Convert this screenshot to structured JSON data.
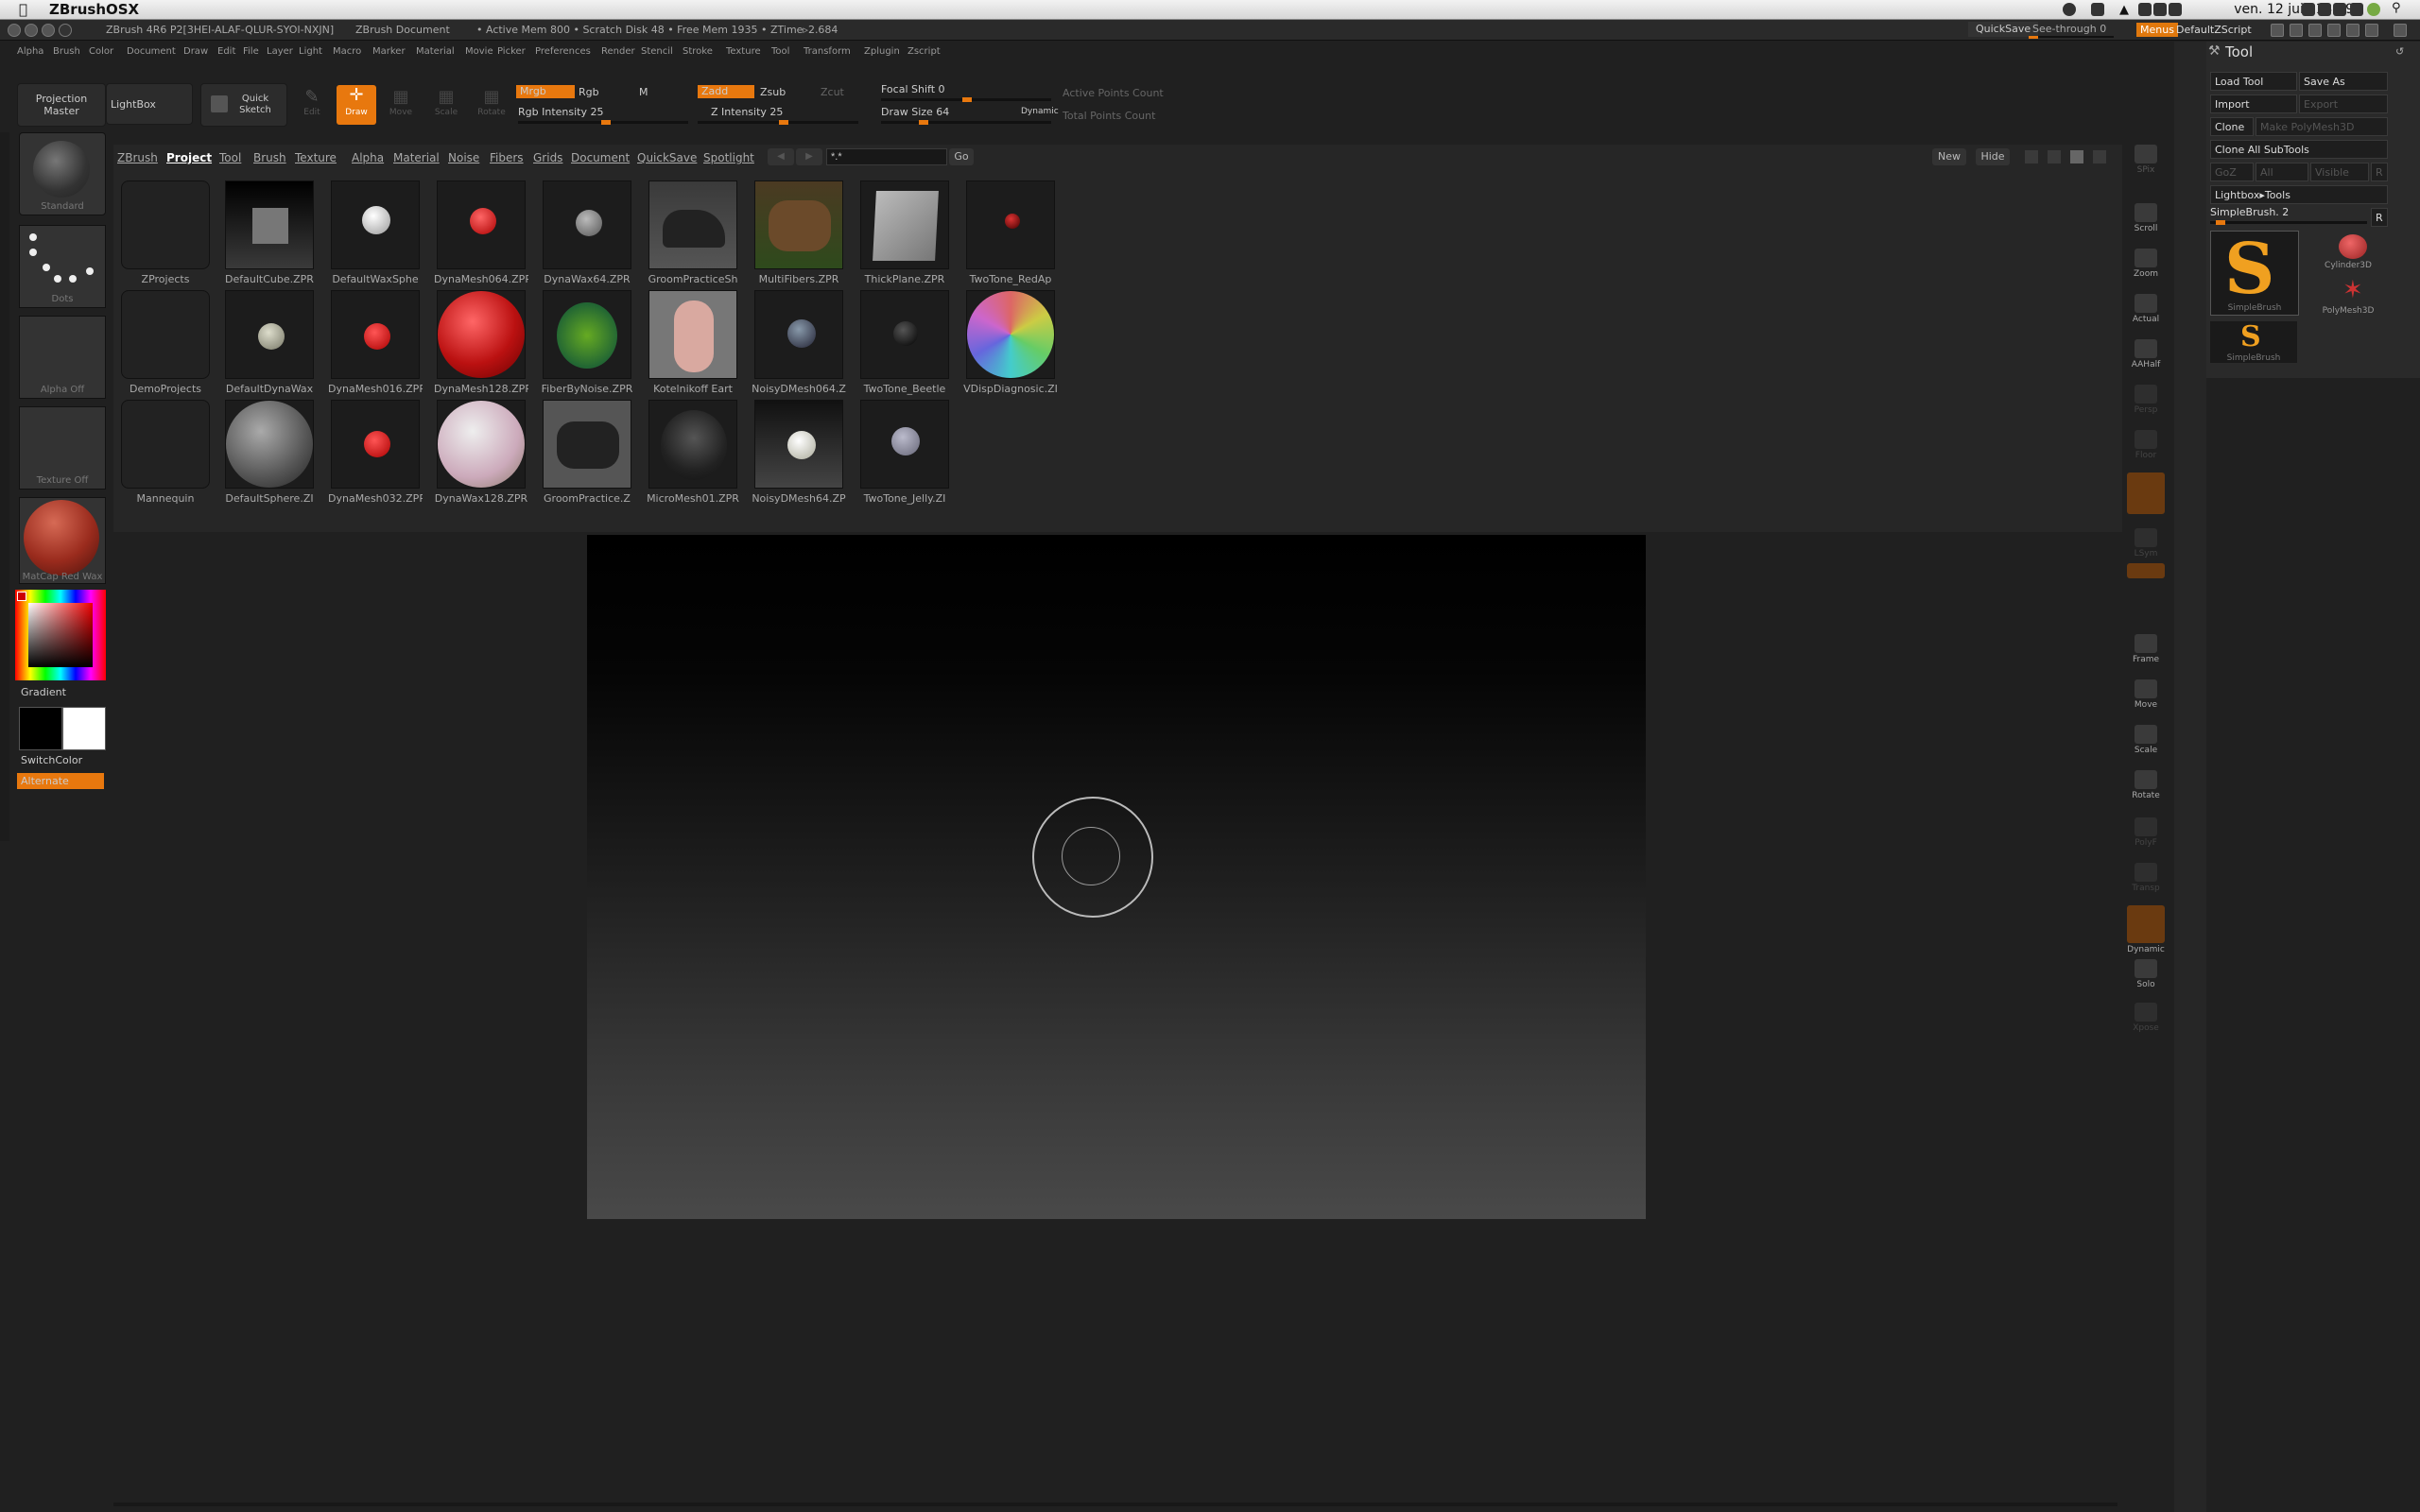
{
  "os_menubar": {
    "app_name": "ZBrushOSX",
    "clock": "ven. 12 juil.  13:19"
  },
  "titlebar": {
    "title": "ZBrush 4R6 P2[3HEI-ALAF-QLUR-SYOI-NXJN]",
    "document": "ZBrush Document",
    "mem": "• Active Mem 800 • Scratch Disk 48 • Free Mem 1935 • ZTime▹2.684",
    "quicksave": "QuickSave",
    "see_through": "See-through  0",
    "menus": "Menus",
    "script": "DefaultZScript"
  },
  "menus": [
    "Alpha",
    "Brush",
    "Color",
    "Document",
    "Draw",
    "Edit",
    "File",
    "Layer",
    "Light",
    "Macro",
    "Marker",
    "Material",
    "Movie",
    "Picker",
    "Preferences",
    "Render",
    "Stencil",
    "Stroke",
    "Texture",
    "Tool",
    "Transform",
    "Zplugin",
    "Zscript"
  ],
  "shelf": {
    "projection_master": "Projection Master",
    "lightbox": "LightBox",
    "quick_sketch": "Quick Sketch",
    "edit": "Edit",
    "draw": "Draw",
    "move": "Move",
    "scale": "Scale",
    "rotate": "Rotate",
    "mrgb": "Mrgb",
    "rgb": "Rgb",
    "m": "M",
    "zadd": "Zadd",
    "zsub": "Zsub",
    "zcut": "Zcut",
    "rgb_intensity": "Rgb Intensity 25",
    "z_intensity": "Z Intensity 25",
    "focal_shift": "Focal Shift 0",
    "draw_size": "Draw Size 64",
    "dynamic": "Dynamic",
    "active_points": "Active Points Count",
    "total_points": "Total Points Count"
  },
  "left_shelf": {
    "brush": "Standard",
    "stroke": "Dots",
    "alpha": "Alpha Off",
    "texture": "Texture Off",
    "material": "MatCap Red Wax",
    "gradient": "Gradient",
    "switch_color": "SwitchColor",
    "alternate": "Alternate"
  },
  "lightbox": {
    "tabs": [
      "ZBrush",
      "Project",
      "Tool",
      "Brush",
      "Texture",
      "Alpha",
      "Material",
      "Noise",
      "Fibers",
      "Grids",
      "Document",
      "QuickSave",
      "Spotlight"
    ],
    "active_tab": "Project",
    "search": "*.*",
    "go": "Go",
    "new": "New",
    "hide": "Hide",
    "folders": [
      "ZProjects",
      "DemoProjects",
      "Mannequin"
    ],
    "rows": [
      [
        "DefaultCube.ZPR",
        "DefaultWaxSphe",
        "DynaMesh064.ZPR",
        "DynaWax64.ZPR",
        "GroomPracticeSh",
        "MultiFibers.ZPR",
        "ThickPlane.ZPR",
        "TwoTone_RedAp"
      ],
      [
        "DefaultDynaWax",
        "DynaMesh016.ZPR",
        "DynaMesh128.ZPR",
        "FiberByNoise.ZPR",
        "Kotelnikoff Eart",
        "NoisyDMesh064.Z",
        "TwoTone_Beetle",
        "VDispDiagnosic.ZI"
      ],
      [
        "DefaultSphere.ZI",
        "DynaMesh032.ZPR",
        "DynaWax128.ZPR",
        "GroomPractice.Z",
        "MicroMesh01.ZPR",
        "NoisyDMesh64.ZP",
        "TwoTone_Jelly.ZI"
      ]
    ]
  },
  "right_shelf": [
    "SPix",
    "Scroll",
    "Zoom",
    "Actual",
    "AAHalf",
    "Persp",
    "Floor",
    "Local",
    "LSym",
    "Xyz",
    "Frame",
    "Move",
    "Scale",
    "Rotate",
    "PolyF",
    "Transp",
    "Dynamic",
    "Solo",
    "Xpose"
  ],
  "tool_palette": {
    "title": "Tool",
    "load_tool": "Load Tool",
    "save_as": "Save As",
    "import": "Import",
    "export": "Export",
    "clone": "Clone",
    "make_polymesh": "Make PolyMesh3D",
    "clone_all": "Clone All SubTools",
    "goz": "GoZ",
    "all": "All",
    "visible": "Visible",
    "r": "R",
    "lightbox_tools": "Lightbox▸Tools",
    "current_tool": "SimpleBrush. 2",
    "tools": [
      "SimpleBrush",
      "Cylinder3D",
      "PolyMesh3D",
      "SimpleBrush"
    ]
  },
  "colors": {
    "accent": "#e8780e",
    "background": "#202020"
  }
}
